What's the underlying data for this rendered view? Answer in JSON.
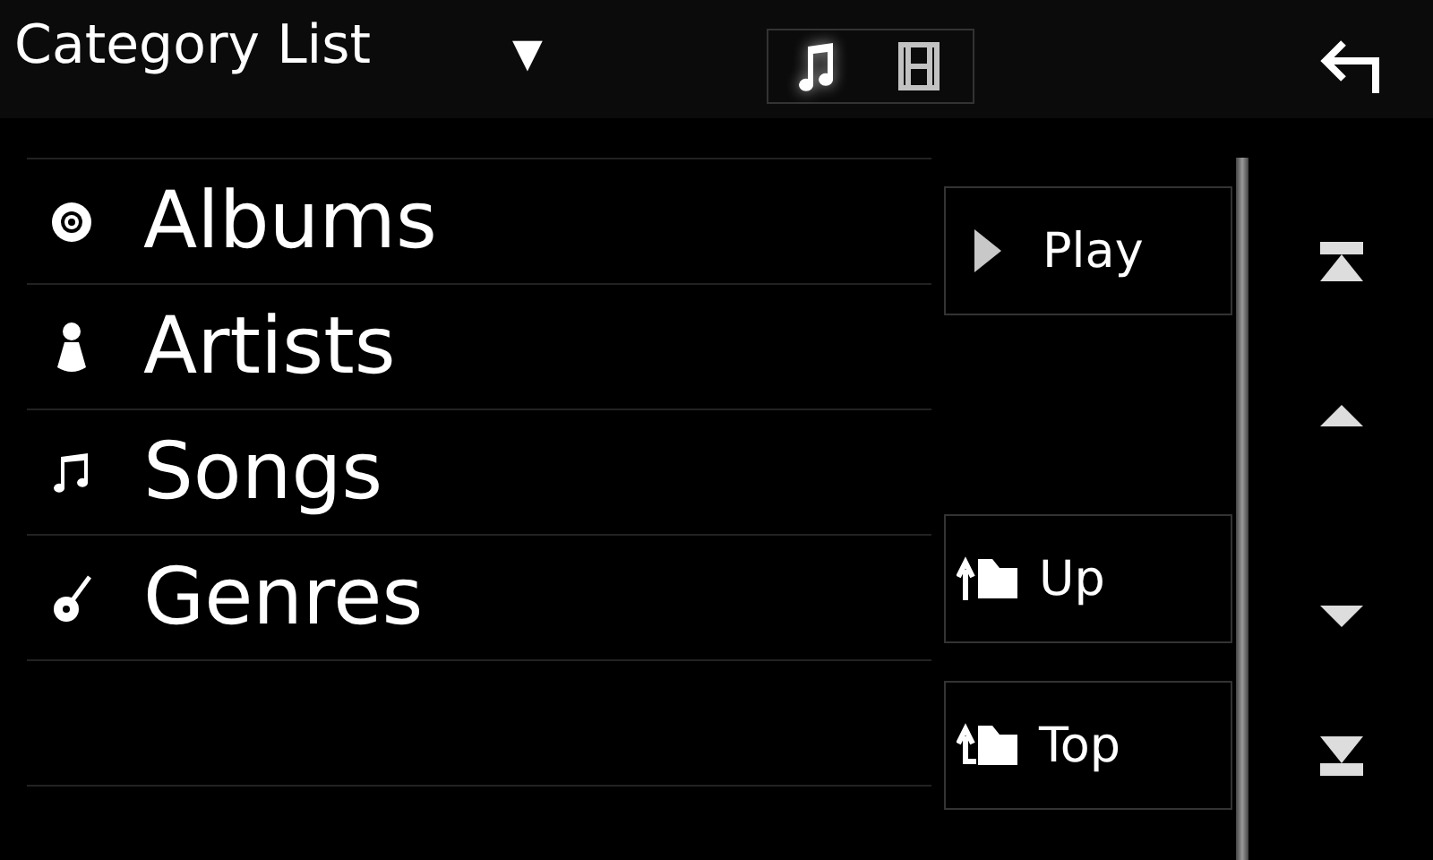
{
  "header": {
    "title": "Category List",
    "dropdown": "▼",
    "media_tabs": [
      {
        "kind": "music",
        "selected": true
      },
      {
        "kind": "video",
        "selected": false
      }
    ]
  },
  "categories": [
    {
      "kind": "album",
      "label": "Albums"
    },
    {
      "kind": "artist",
      "label": "Artists"
    },
    {
      "kind": "song",
      "label": "Songs"
    },
    {
      "kind": "genre",
      "label": "Genres"
    }
  ],
  "actions": [
    {
      "kind": "play",
      "label": "Play"
    },
    {
      "kind": "up",
      "label": "Up"
    },
    {
      "kind": "top",
      "label": "Top"
    }
  ],
  "scroll_buttons": [
    {
      "kind": "first"
    },
    {
      "kind": "up"
    },
    {
      "kind": "down"
    },
    {
      "kind": "last"
    }
  ]
}
